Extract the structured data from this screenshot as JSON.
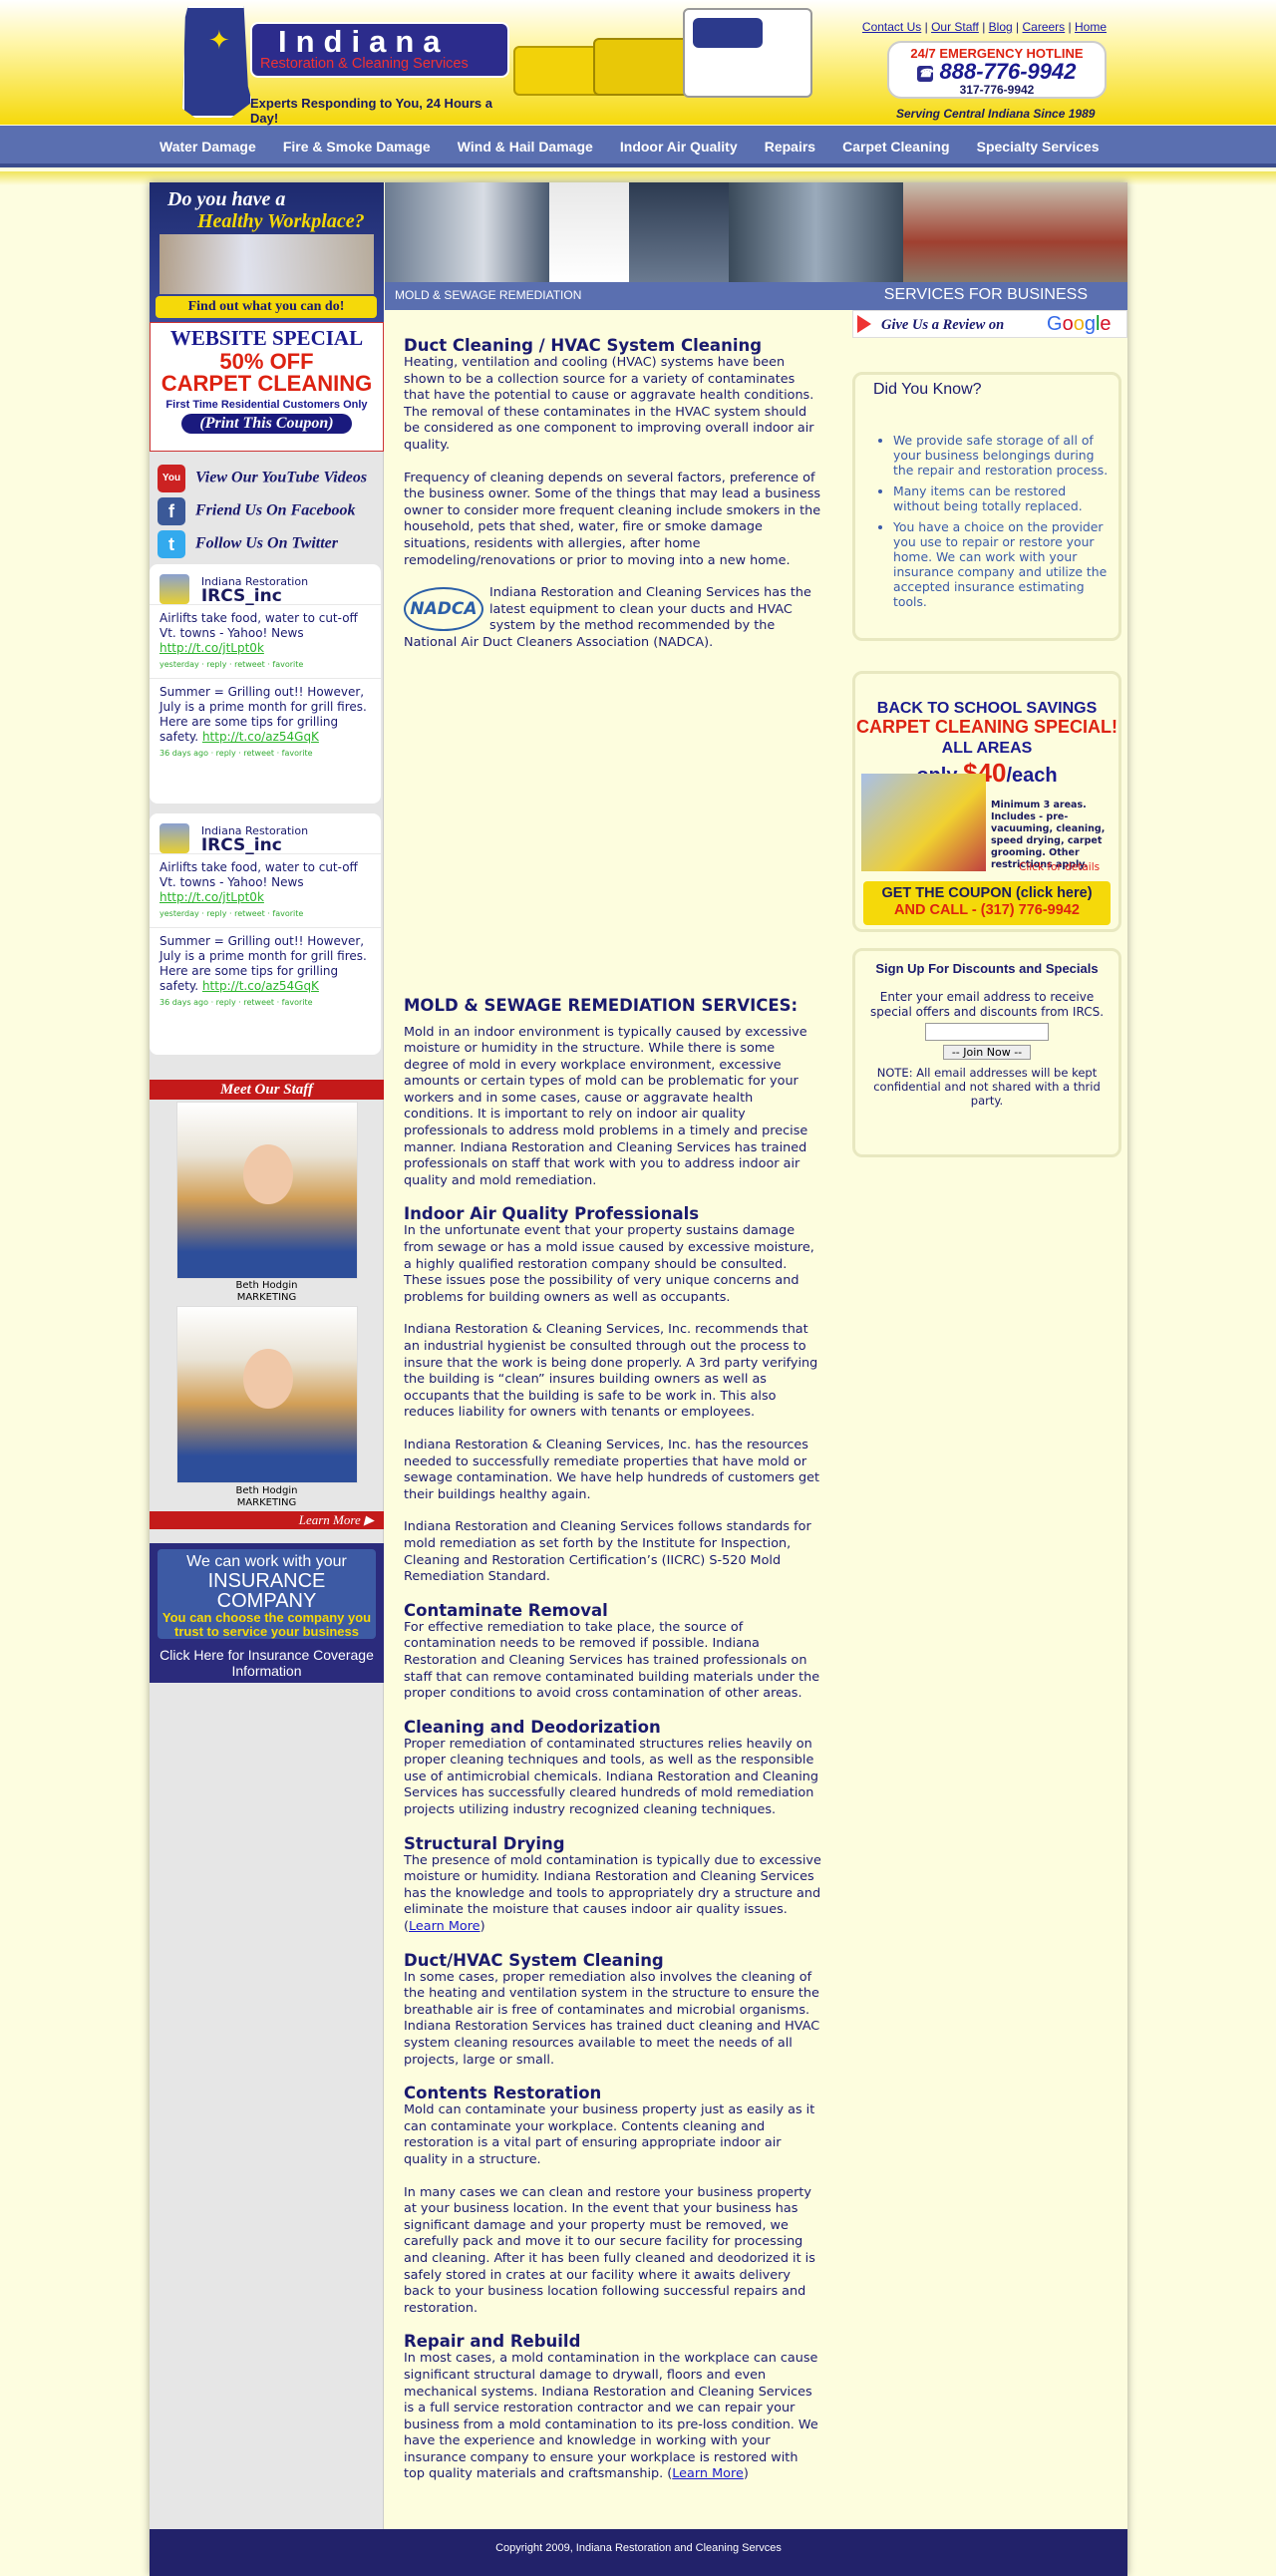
{
  "header": {
    "logo_title": "Indiana",
    "logo_subtitle": "Restoration & Cleaning Services",
    "tagline": "Experts Responding to You,  24 Hours a Day!",
    "top_links": [
      "Contact Us",
      "Our Staff",
      "Blog",
      "Careers",
      "Home"
    ],
    "hotline_label": "24/7 EMERGENCY HOTLINE",
    "hotline_number": "888-776-9942",
    "local_number": "317-776-9942",
    "serving": "Serving Central Indiana Since 1989"
  },
  "nav": {
    "items": [
      "Water Damage",
      "Fire & Smoke Damage",
      "Wind & Hail Damage",
      "Indoor Air Quality",
      "Repairs",
      "Carpet Cleaning",
      "Specialty Services"
    ]
  },
  "sidebar": {
    "workplace_q1": "Do you have a",
    "workplace_q2": "Healthy Workplace?",
    "workplace_cta": "Find out what you can do!",
    "special_title": "WEBSITE SPECIAL",
    "special_offer_1": "50% OFF",
    "special_offer_2": "CARPET CLEANING",
    "special_note": "First Time Residential Customers Only",
    "special_button": "(Print This Coupon)",
    "social": [
      {
        "icon": "youtube-icon",
        "label": "View Our YouTube Videos",
        "color": "#cc2222",
        "icon_text": "You Tube"
      },
      {
        "icon": "facebook-icon",
        "label": "Friend Us On Facebook",
        "color": "#3b5998",
        "icon_text": "f"
      },
      {
        "icon": "twitter-icon",
        "label": "Follow Us On Twitter",
        "color": "#33aaee",
        "icon_text": "t"
      }
    ],
    "twitter": {
      "account_label": "Indiana Restoration",
      "handle": "IRCS_inc",
      "tweets": [
        {
          "text": "Airlifts take food, water to cut-off Vt. towns - Yahoo! News",
          "link": "http://t.co/jtLpt0k",
          "meta": "yesterday · reply · retweet · favorite"
        },
        {
          "text": "Summer = Grilling out!! However, July is a prime month for grill fires. Here are some tips for grilling safety.",
          "link": "http://t.co/az54GqK",
          "meta": "36 days ago · reply · retweet · favorite"
        }
      ]
    },
    "staff_heading": "Meet Our Staff",
    "staff": [
      {
        "name": "Beth Hodgin",
        "role": "MARKETING"
      },
      {
        "name": "Beth Hodgin",
        "role": "MARKETING"
      }
    ],
    "learn_more": "Learn More",
    "insurance_1": "We can work with your",
    "insurance_2": "INSURANCE COMPANY",
    "insurance_3": "You can choose the company you trust to service your business",
    "insurance_4": "Click Here for Insurance Coverage Information"
  },
  "banner": {
    "breadcrumb": "MOLD & SEWAGE REMEDIATION",
    "services_label": "SERVICES FOR BUSINESS",
    "review_text": "Give Us a Review on",
    "review_brand": "Google"
  },
  "content": {
    "h_duct": "Duct Cleaning / HVAC System Cleaning",
    "p_duct_1": "Heating, ventilation and cooling (HVAC) systems have been shown to be a collection source for a variety of contaminates that have the potential to cause or aggravate health conditions. The removal of these contaminates in the HVAC system should be considered as one component to improving overall indoor air quality.",
    "p_duct_2": "Frequency of cleaning depends on several factors, preference of the business owner. Some of the things that may lead a business owner to consider more frequent cleaning include smokers in the household, pets that shed, water, fire or smoke damage situations, residents with allergies, after home remodeling/renovations or prior to moving into a new home.",
    "nadca_logo": "NADCA",
    "p_nadca": "Indiana Restoration and Cleaning Services has the latest equipment to clean your ducts and HVAC system by the method recommended by the National Air Duct Cleaners Association (NADCA).",
    "h_mold": "MOLD & SEWAGE REMEDIATION SERVICES:",
    "p_mold": "Mold in an indoor environment is typically caused by excessive moisture or humidity in the structure. While there is some degree of mold in every workplace environment, excessive amounts or certain types of mold can be problematic for your workers and in some cases, cause or aggravate health conditions. It is important to rely on indoor air quality professionals to address mold problems in a timely and precise manner. Indiana Restoration and Cleaning Services has trained professionals on staff that work with you to address indoor air quality and mold remediation.",
    "h_iaq": "Indoor Air Quality Professionals",
    "p_iaq_1": "In the unfortunate event that your property sustains damage from sewage or has a mold issue caused by excessive moisture, a highly qualified restoration company should be consulted. These issues pose the possibility of very unique concerns and problems for building owners as well as occupants.",
    "p_iaq_2": "Indiana Restoration & Cleaning Services, Inc. recommends that an industrial hygienist be consulted through out the process to insure that the work is being done properly. A 3rd party verifying the building is “clean” insures building owners as well as occupants that the building is safe to be work in. This also reduces liability for owners with tenants or employees.",
    "p_iaq_3": "Indiana Restoration & Cleaning Services, Inc. has the resources needed to successfully remediate properties that have mold or sewage contamination. We have help hundreds of customers get their buildings healthy again.",
    "p_iaq_4": "Indiana Restoration and Cleaning Services follows standards for mold remediation as set forth by the Institute for Inspection, Cleaning and Restoration Certification’s (IICRC) S-520 Mold Remediation Standard.",
    "h_contaminate": "Contaminate Removal",
    "p_contaminate": "For effective remediation to take place, the source of contamination needs to be removed if possible. Indiana Restoration and Cleaning Services has trained professionals on staff that can remove contaminated building materials under the proper conditions to avoid cross contamination of other areas.",
    "h_deodor": "Cleaning and Deodorization",
    "p_deodor": "Proper remediation of contaminated structures relies heavily on proper cleaning techniques and tools, as well as the responsible use of antimicrobial chemicals. Indiana Restoration and Cleaning Services has successfully cleared hundreds of mold remediation projects utilizing industry recognized cleaning techniques.",
    "h_drying": "Structural Drying",
    "p_drying": "The presence of mold contamination is typically due to excessive moisture or humidity. Indiana Restoration and Cleaning Services has the knowledge and tools to appropriately dry a structure and eliminate the moisture that causes indoor air quality issues.",
    "h_hvac2": "Duct/HVAC System Cleaning",
    "p_hvac2": "In some cases, proper remediation also involves the cleaning of the heating and ventilation system in the structure to ensure the breathable air is free of contaminates and microbial organisms. Indiana Restoration Services has trained duct cleaning and HVAC system cleaning resources available to meet the needs of all projects, large or small.",
    "h_contents": "Contents Restoration",
    "p_contents_1": "Mold can contaminate your business property just as easily as it can contaminate your workplace. Contents cleaning and restoration is a vital part of ensuring appropriate indoor air quality in a structure.",
    "p_contents_2": "In many cases we can clean and restore your business property at your business location. In the event that your business has significant damage and your property must be removed, we carefully pack and move it to our secure facility for processing and cleaning. After it has been fully cleaned and deodorized it is safely stored in crates at our facility where it awaits delivery back to your business location following successful repairs and restoration.",
    "h_repair": "Repair and Rebuild",
    "p_repair": "In most cases, a mold contamination in the workplace can cause significant structural damage to drywall, floors and even mechanical systems. Indiana Restoration and Cleaning Services is a full service restoration contractor and we can repair your business from a mold contamination to its pre-loss condition. We have the experience and knowledge in working with your insurance company to ensure your workplace is restored with top quality materials and craftsmanship.",
    "learn_more_link": "Learn More"
  },
  "right": {
    "dyk_title": "Did You Know?",
    "dyk_items": [
      "We provide safe storage of all of your business belongings during the repair and restoration process.",
      "Many items can be restored without being totally replaced.",
      "You have a choice on the provider you use to repair or restore your home. We can work with your insurance company and utilize the accepted insurance estimating tools."
    ],
    "school_1": "BACK TO SCHOOL SAVINGS",
    "school_2": "CARPET CLEANING SPECIAL!",
    "school_3": "ALL AREAS",
    "school_4_pre": "only",
    "school_4_price": "$40",
    "school_4_post": "/each",
    "school_details": "Minimum 3 areas. Includes - pre-vacuuming, cleaning, speed drying, carpet grooming. Other restrictions apply.",
    "school_click": "Click for details",
    "school_cta_1": "GET THE COUPON (click here)",
    "school_cta_2": "AND CALL - (317) 776-9942",
    "signup_title": "Sign Up For Discounts and Specials",
    "signup_text": "Enter your email address to receive special offers and discounts from IRCS.",
    "signup_button": "-- Join Now --",
    "signup_note": "NOTE: All email addresses will be kept confidential and not shared with a thrid party."
  },
  "footer": {
    "copyright": "Copyright 2009, Indiana Restoration and Cleaning Servces"
  }
}
